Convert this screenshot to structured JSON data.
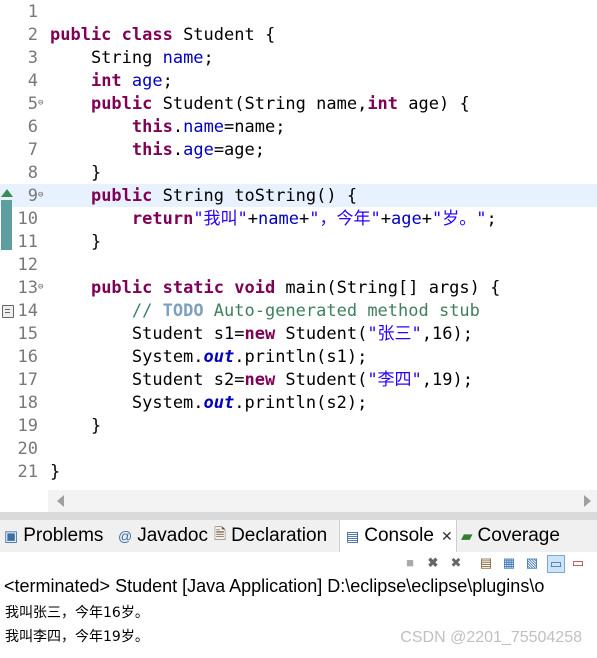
{
  "editor": {
    "lines": [
      {
        "n": "1",
        "fold": "",
        "code": []
      },
      {
        "n": "2",
        "fold": "",
        "code": [
          {
            "t": "public class",
            "c": "kw"
          },
          {
            "t": " Student {",
            "c": ""
          }
        ]
      },
      {
        "n": "3",
        "fold": "",
        "code": [
          {
            "t": "    String ",
            "c": ""
          },
          {
            "t": "name",
            "c": "fld"
          },
          {
            "t": ";",
            "c": ""
          }
        ]
      },
      {
        "n": "4",
        "fold": "",
        "code": [
          {
            "t": "    ",
            "c": ""
          },
          {
            "t": "int",
            "c": "kw"
          },
          {
            "t": " ",
            "c": ""
          },
          {
            "t": "age",
            "c": "fld"
          },
          {
            "t": ";",
            "c": ""
          }
        ]
      },
      {
        "n": "5",
        "fold": "⊖",
        "code": [
          {
            "t": "    ",
            "c": ""
          },
          {
            "t": "public",
            "c": "kw"
          },
          {
            "t": " Student(String name,",
            "c": ""
          },
          {
            "t": "int",
            "c": "kw"
          },
          {
            "t": " age) {",
            "c": ""
          }
        ]
      },
      {
        "n": "6",
        "fold": "",
        "code": [
          {
            "t": "        ",
            "c": ""
          },
          {
            "t": "this",
            "c": "kw"
          },
          {
            "t": ".",
            "c": ""
          },
          {
            "t": "name",
            "c": "fld"
          },
          {
            "t": "=name;",
            "c": ""
          }
        ]
      },
      {
        "n": "7",
        "fold": "",
        "code": [
          {
            "t": "        ",
            "c": ""
          },
          {
            "t": "this",
            "c": "kw"
          },
          {
            "t": ".",
            "c": ""
          },
          {
            "t": "age",
            "c": "fld"
          },
          {
            "t": "=age;",
            "c": ""
          }
        ]
      },
      {
        "n": "8",
        "fold": "",
        "code": [
          {
            "t": "    }",
            "c": ""
          }
        ]
      },
      {
        "n": "9",
        "fold": "⊖",
        "code": [
          {
            "t": "    ",
            "c": ""
          },
          {
            "t": "public",
            "c": "kw"
          },
          {
            "t": " String toString() {",
            "c": ""
          }
        ]
      },
      {
        "n": "10",
        "fold": "",
        "code": [
          {
            "t": "        ",
            "c": ""
          },
          {
            "t": "return",
            "c": "kw"
          },
          {
            "t": "\"我叫\"",
            "c": "str"
          },
          {
            "t": "+",
            "c": ""
          },
          {
            "t": "name",
            "c": "fld"
          },
          {
            "t": "+",
            "c": ""
          },
          {
            "t": "\"，今年\"",
            "c": "str"
          },
          {
            "t": "+",
            "c": ""
          },
          {
            "t": "age",
            "c": "fld"
          },
          {
            "t": "+",
            "c": ""
          },
          {
            "t": "\"岁。\"",
            "c": "str"
          },
          {
            "t": ";",
            "c": ""
          }
        ]
      },
      {
        "n": "11",
        "fold": "",
        "code": [
          {
            "t": "    }",
            "c": ""
          }
        ]
      },
      {
        "n": "12",
        "fold": "",
        "code": []
      },
      {
        "n": "13",
        "fold": "⊖",
        "code": [
          {
            "t": "    ",
            "c": ""
          },
          {
            "t": "public static void",
            "c": "kw"
          },
          {
            "t": " main(String[] args) {",
            "c": ""
          }
        ]
      },
      {
        "n": "14",
        "fold": "",
        "code": [
          {
            "t": "        ",
            "c": ""
          },
          {
            "t": "// ",
            "c": "cm"
          },
          {
            "t": "TODO",
            "c": "todo"
          },
          {
            "t": " Auto-generated method stub",
            "c": "cm"
          }
        ]
      },
      {
        "n": "15",
        "fold": "",
        "code": [
          {
            "t": "        Student s1=",
            "c": ""
          },
          {
            "t": "new",
            "c": "kw"
          },
          {
            "t": " Student(",
            "c": ""
          },
          {
            "t": "\"张三\"",
            "c": "str"
          },
          {
            "t": ",16);",
            "c": ""
          }
        ]
      },
      {
        "n": "16",
        "fold": "",
        "code": [
          {
            "t": "        System.",
            "c": ""
          },
          {
            "t": "out",
            "c": "st"
          },
          {
            "t": ".println(s1);",
            "c": ""
          }
        ]
      },
      {
        "n": "17",
        "fold": "",
        "code": [
          {
            "t": "        Student s2=",
            "c": ""
          },
          {
            "t": "new",
            "c": "kw"
          },
          {
            "t": " Student(",
            "c": ""
          },
          {
            "t": "\"李四\"",
            "c": "str"
          },
          {
            "t": ",19);",
            "c": ""
          }
        ]
      },
      {
        "n": "18",
        "fold": "",
        "code": [
          {
            "t": "        System.",
            "c": ""
          },
          {
            "t": "out",
            "c": "st"
          },
          {
            "t": ".println(s2);",
            "c": ""
          }
        ]
      },
      {
        "n": "19",
        "fold": "",
        "code": [
          {
            "t": "    }",
            "c": ""
          }
        ]
      },
      {
        "n": "20",
        "fold": "",
        "code": []
      },
      {
        "n": "21",
        "fold": "",
        "code": [
          {
            "t": "}",
            "c": ""
          }
        ]
      }
    ],
    "current_line": "9"
  },
  "panel": {
    "tabs": [
      {
        "label": "Problems",
        "icon": "problems-icon",
        "glyph": "▣",
        "color": "#3a6ea5"
      },
      {
        "label": "Javadoc",
        "icon": "javadoc-icon",
        "glyph": "@",
        "color": "#3a6ea5"
      },
      {
        "label": "Declaration",
        "icon": "declaration-icon",
        "glyph": "🗎",
        "color": "#6d4c2f"
      },
      {
        "label": "Console",
        "icon": "console-icon",
        "glyph": "▤",
        "color": "#1f4f8f"
      },
      {
        "label": "Coverage",
        "icon": "coverage-icon",
        "glyph": "▰",
        "color": "#2f7f2f"
      }
    ],
    "active_tab": "Console",
    "close_glyph": "✕",
    "status": "<terminated> Student [Java Application] D:\\eclipse\\eclipse\\plugins\\o",
    "output": [
      "我叫张三，今年16岁。",
      "我叫李四，今年19岁。"
    ]
  },
  "watermark": "CSDN @2201_75504258"
}
